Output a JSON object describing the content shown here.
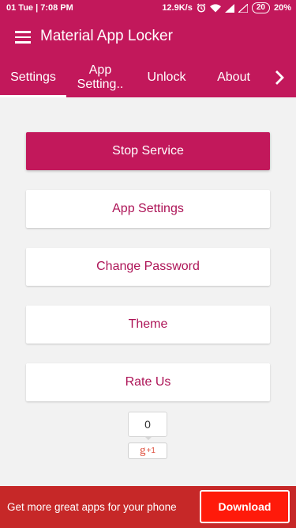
{
  "status_bar": {
    "time": "01 Tue | 7:08 PM",
    "network_speed": "12.9K/s",
    "battery_level": "20",
    "battery_percent": "20%",
    "icons": [
      "alarm-icon",
      "wifi-icon",
      "signal-icon",
      "signal-icon"
    ]
  },
  "app_bar": {
    "title": "Material App Locker",
    "menu_icon": "hamburger-menu-icon"
  },
  "tabs": {
    "items": [
      {
        "label": "Settings",
        "selected": true
      },
      {
        "label": "App\nSetting..",
        "selected": false
      },
      {
        "label": "Unlock",
        "selected": false
      },
      {
        "label": "About",
        "selected": false
      }
    ],
    "next_icon": "chevron-right-icon"
  },
  "buttons": {
    "stop_service": "Stop Service",
    "app_settings": "App Settings",
    "change_password": "Change Password",
    "theme": "Theme",
    "rate_us": "Rate Us"
  },
  "gplus": {
    "count": "0",
    "label_g": "g",
    "label_plus": "+1"
  },
  "ad_banner": {
    "text": "Get more great apps for your phone",
    "download_label": "Download"
  },
  "colors": {
    "primary": "#c2185b",
    "button_text": "#ad1457",
    "background": "#f2f2f2",
    "ad_background": "#c62828",
    "download_button": "#ff1a0a"
  }
}
